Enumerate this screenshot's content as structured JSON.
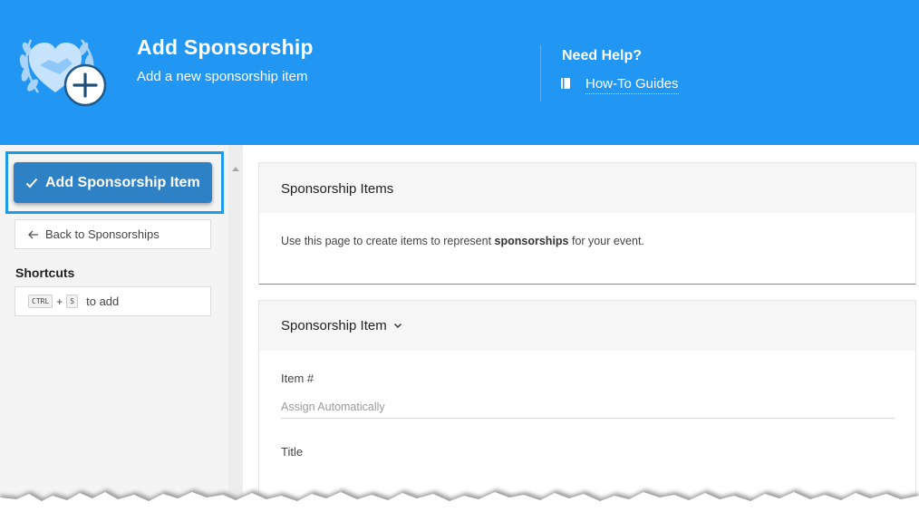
{
  "header": {
    "title": "Add Sponsorship",
    "subtitle": "Add a new sponsorship item",
    "help_title": "Need Help?",
    "help_link": "How-To Guides",
    "logo_icon": "sponsorship-handshake-heart-icon",
    "background_color": "#2196F3"
  },
  "sidebar": {
    "primary_button": "Add Sponsorship Item",
    "back_button": "Back to Sponsorships",
    "shortcuts_label": "Shortcuts",
    "shortcut": {
      "key1": "CTRL",
      "plus": "+",
      "key2": "S",
      "action": "to add"
    },
    "accent_color": "#2f81c6"
  },
  "main": {
    "card1": {
      "title": "Sponsorship Items",
      "body_prefix": "Use this page to create items to represent ",
      "body_bold": "sponsorships",
      "body_suffix": " for your event."
    },
    "card2": {
      "title": "Sponsorship Item",
      "item_number_label": "Item #",
      "item_number_placeholder": "Assign Automatically",
      "title_label": "Title"
    }
  }
}
